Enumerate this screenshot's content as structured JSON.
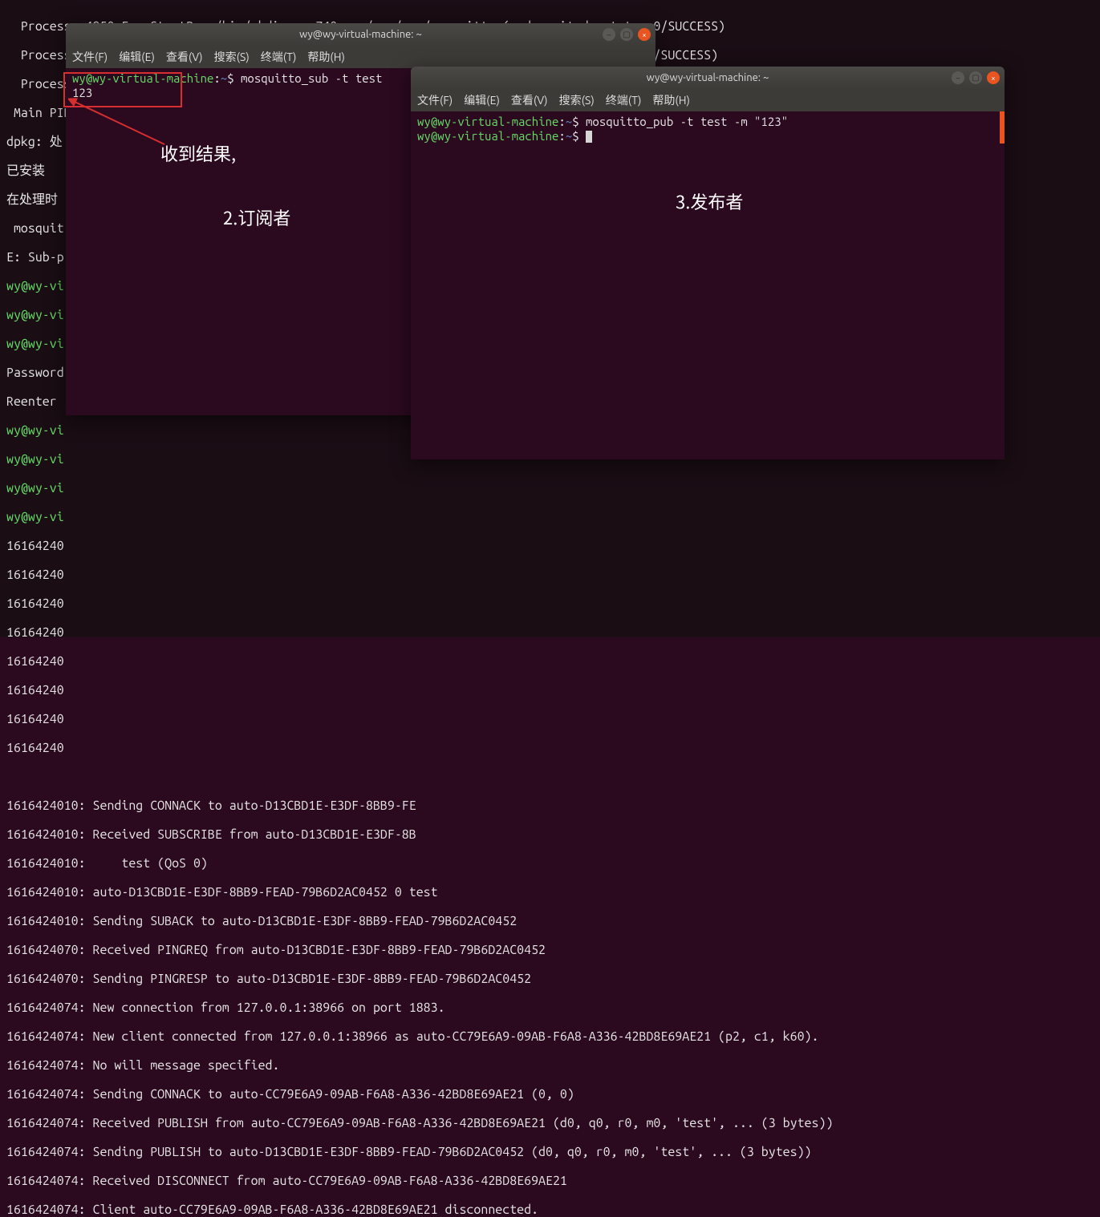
{
  "desktop": {
    "menu_hint_truncated": ""
  },
  "bg_terminal": {
    "lines_top": [
      "  Process: 4950 ExecStartPre=/bin/mkdir -m 740 -p /var/run/mosquitto (code=exited, status=0/SUCCESS)",
      "  Process                                                                               =0/SUCCESS)",
      "  Process                                                                               0/SUCCESS)",
      " Main PID",
      "dpkg: 处",
      "已安装",
      "在处理时",
      " mosquit",
      "E: Sub-p"
    ],
    "prompt_prefix": "wy@wy-vi",
    "other_lines_partial": [
      "Password",
      "Reenter "
    ],
    "numeric_scroll": [
      "16164240",
      "16164240",
      "16164240",
      "16164240",
      "16164240",
      "16164240",
      "16164240",
      "16164240"
    ],
    "log_lines": [
      "1616424010: Sending CONNACK to auto-D13CBD1E-E3DF-8BB9-FE",
      "1616424010: Received SUBSCRIBE from auto-D13CBD1E-E3DF-8B",
      "1616424010:     test (QoS 0)",
      "1616424010: auto-D13CBD1E-E3DF-8BB9-FEAD-79B6D2AC0452 0 test",
      "1616424010: Sending SUBACK to auto-D13CBD1E-E3DF-8BB9-FEAD-79B6D2AC0452",
      "1616424070: Received PINGREQ from auto-D13CBD1E-E3DF-8BB9-FEAD-79B6D2AC0452",
      "1616424070: Sending PINGRESP to auto-D13CBD1E-E3DF-8BB9-FEAD-79B6D2AC0452",
      "1616424074: New connection from 127.0.0.1:38966 on port 1883.",
      "1616424074: New client connected from 127.0.0.1:38966 as auto-CC79E6A9-09AB-F6A8-A336-42BD8E69AE21 (p2, c1, k60).",
      "1616424074: No will message specified.",
      "1616424074: Sending CONNACK to auto-CC79E6A9-09AB-F6A8-A336-42BD8E69AE21 (0, 0)",
      "1616424074: Received PUBLISH from auto-CC79E6A9-09AB-F6A8-A336-42BD8E69AE21 (d0, q0, r0, m0, 'test', ... (3 bytes))",
      "1616424074: Sending PUBLISH to auto-D13CBD1E-E3DF-8BB9-FEAD-79B6D2AC0452 (d0, q0, r0, m0, 'test', ... (3 bytes))",
      "1616424074: Received DISCONNECT from auto-CC79E6A9-09AB-F6A8-A336-42BD8E69AE21",
      "1616424074: Client auto-CC79E6A9-09AB-F6A8-A336-42BD8E69AE21 disconnected."
    ]
  },
  "window_sub": {
    "title": "wy@wy-virtual-machine: ~",
    "menu": {
      "file": "文件(F)",
      "edit": "编辑(E)",
      "view": "查看(V)",
      "search": "搜索(S)",
      "terminal": "终端(T)",
      "help": "帮助(H)"
    },
    "prompt": {
      "user": "wy@wy-virtual-machine",
      "sep": ":",
      "path": "~",
      "end": "$ "
    },
    "command": "mosquitto_sub -t test",
    "output": "123"
  },
  "window_pub": {
    "title": "wy@wy-virtual-machine: ~",
    "menu": {
      "file": "文件(F)",
      "edit": "编辑(E)",
      "view": "查看(V)",
      "search": "搜索(S)",
      "terminal": "终端(T)",
      "help": "帮助(H)"
    },
    "prompt": {
      "user": "wy@wy-virtual-machine",
      "sep": ":",
      "path": "~",
      "end": "$ "
    },
    "command": "mosquitto_pub -t test -m \"123\""
  },
  "annotations": {
    "result": "收到结果,",
    "subscriber": "2.订阅者",
    "publisher": "3.发布者"
  }
}
